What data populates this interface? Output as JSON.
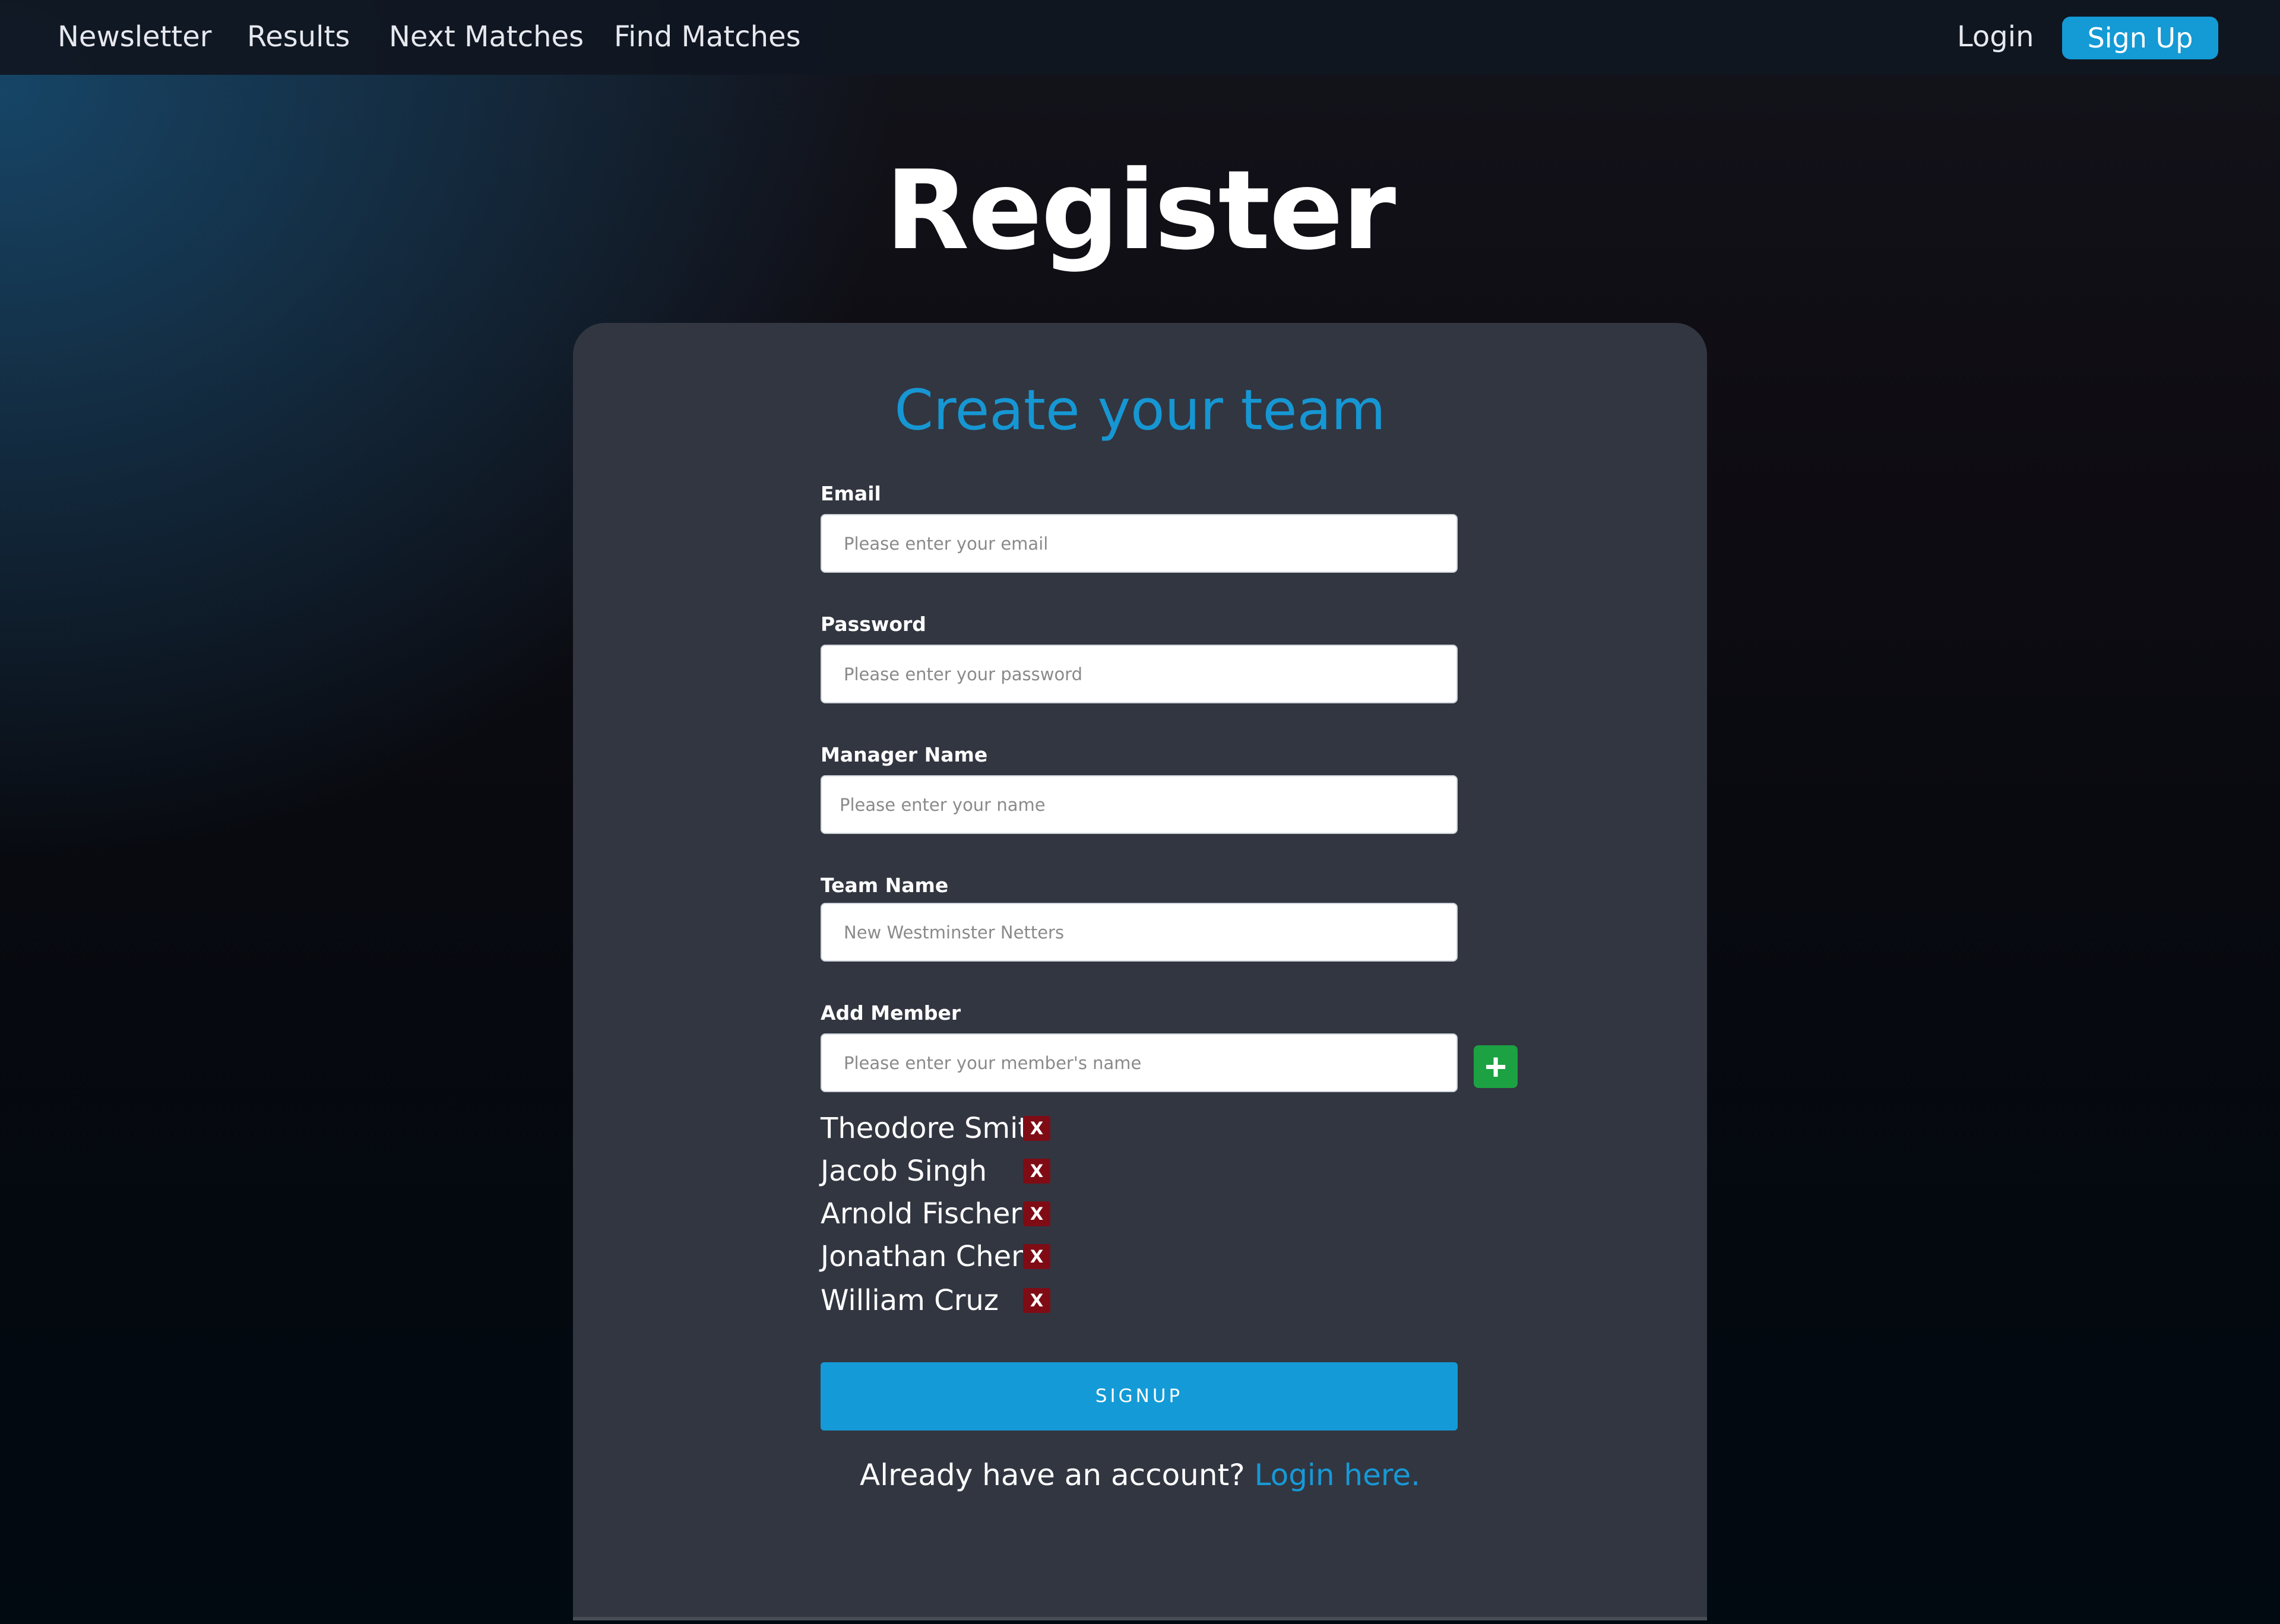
{
  "nav": {
    "links": [
      "Newsletter",
      "Results",
      "Next Matches",
      "Find Matches"
    ],
    "login": "Login",
    "signup": "Sign Up"
  },
  "page_title": "Register",
  "form": {
    "title": "Create your team",
    "email": {
      "label": "Email",
      "placeholder": "Please enter your email"
    },
    "password": {
      "label": "Password",
      "placeholder": "Please enter your password"
    },
    "manager": {
      "label": "Manager Name",
      "placeholder": "Please enter your name"
    },
    "team": {
      "label": "Team Name",
      "placeholder": "New Westminster Netters"
    },
    "member": {
      "label": "Add Member",
      "placeholder": "Please enter your member's name"
    },
    "add_icon": "plus-icon",
    "members": [
      "Theodore Smith",
      "Jacob Singh",
      "Arnold Fischer",
      "Jonathan Chen",
      "William Cruz"
    ],
    "remove_label": "X",
    "submit": "SIGNUP",
    "footer_text": "Already have an account?",
    "footer_link": "Login here."
  },
  "colors": {
    "accent": "#149AD5",
    "card": "#323641",
    "add_button": "#1CA143",
    "remove_button": "#7F0C15"
  }
}
